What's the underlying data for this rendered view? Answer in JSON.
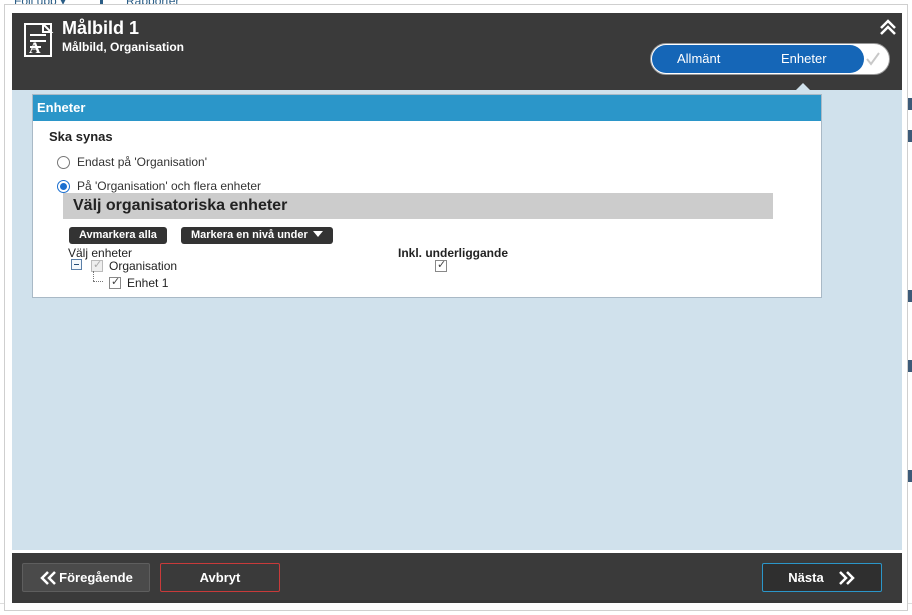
{
  "background": {
    "top_left_text": "Följ upp ▾",
    "top_mid_text": "Rapporter"
  },
  "header": {
    "title": "Målbild 1",
    "subtitle": "Målbild, Organisation",
    "icon": "document-icon",
    "collapse_icon": "double-chevron-up-icon"
  },
  "steps": {
    "items": [
      "Allmänt",
      "Enheter"
    ],
    "active": "Enheter",
    "confirm_icon": "check-icon",
    "accent": "#1566b7"
  },
  "panel": {
    "title": "Enheter",
    "section_label": "Ska synas",
    "options": [
      {
        "label": "Endast på 'Organisation'",
        "selected": false
      },
      {
        "label": "På 'Organisation' och flera enheter",
        "selected": true
      }
    ],
    "org_box_title": "Välj organisatoriska enheter",
    "deselect_all_label": "Avmarkera alla",
    "mark_level_label": "Markera en nivå under",
    "col_units": "Välj enheter",
    "col_include": "Inkl. underliggande",
    "tree": [
      {
        "label": "Organisation",
        "checked": true,
        "disabled": true,
        "include_sub": true
      },
      {
        "label": "Enhet 1",
        "checked": true,
        "disabled": false
      }
    ]
  },
  "footer": {
    "prev_label": "Föregående",
    "cancel_label": "Avbryt",
    "next_label": "Nästa"
  },
  "colors": {
    "header_bg": "#3a3a3a",
    "panel_head": "#2b96c9",
    "content_bg": "#d0e1ec",
    "cancel_border": "#c83a3a",
    "next_border": "#2b96c9"
  }
}
